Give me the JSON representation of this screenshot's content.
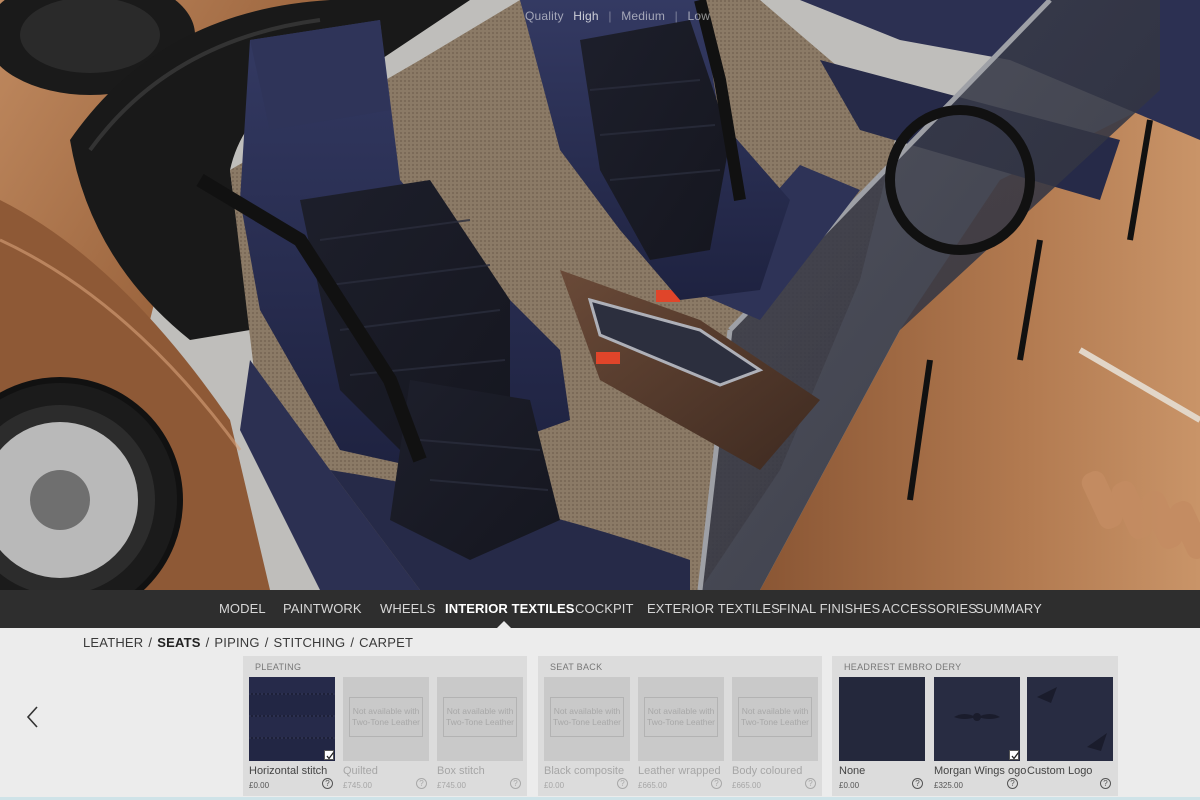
{
  "viewport": {
    "quality": {
      "label": "Quality",
      "options": [
        "High",
        "Medium",
        "Low"
      ],
      "selected": "High"
    }
  },
  "nav": {
    "items": [
      "MODEL",
      "PAINTWORK",
      "WHEELS",
      "INTERIOR TEXTILES",
      "COCKPIT",
      "EXTERIOR TEXTILES",
      "FINAL FINISHES",
      "ACCESSORIES",
      "SUMMARY"
    ],
    "active": "INTERIOR TEXTILES"
  },
  "subnav": {
    "items": [
      "LEATHER",
      "SEATS",
      "PIPING",
      "STITCHING",
      "CARPET"
    ],
    "active": "SEATS"
  },
  "groups": [
    {
      "title": "PLEATING",
      "options": [
        {
          "name": "Horizontal stitch",
          "price": "£0.00",
          "selected": true,
          "available": true
        },
        {
          "name": "Quilted",
          "price": "£745.00",
          "selected": false,
          "available": false,
          "note": "Not available with Two-Tone Leather"
        },
        {
          "name": "Box stitch",
          "price": "£745.00",
          "selected": false,
          "available": false,
          "note": "Not available with Two-Tone Leather"
        }
      ]
    },
    {
      "title": "SEAT BACK",
      "options": [
        {
          "name": "Black composite",
          "price": "£0.00",
          "selected": false,
          "available": false,
          "note": "Not available with Two-Tone Leather"
        },
        {
          "name": "Leather wrapped",
          "price": "£665.00",
          "selected": false,
          "available": false,
          "note": "Not available with Two-Tone Leather"
        },
        {
          "name": "Body coloured",
          "price": "£665.00",
          "selected": false,
          "available": false,
          "note": "Not available with Two-Tone Leather"
        }
      ]
    },
    {
      "title": "HEADREST EMBRO DERY",
      "options": [
        {
          "name": "None",
          "price": "£0.00",
          "selected": false,
          "available": true
        },
        {
          "name": "Morgan Wings ogo",
          "price": "£325.00",
          "selected": true,
          "available": true
        },
        {
          "name": "Custom Logo",
          "price": "",
          "selected": false,
          "available": true
        }
      ]
    }
  ],
  "colors": {
    "nav_bg": "#2e2e2e",
    "panel_bg": "#ececec",
    "group_bg": "#dcdcdc",
    "leather_navy": "#262a48",
    "body_copper": "#a0673f"
  }
}
